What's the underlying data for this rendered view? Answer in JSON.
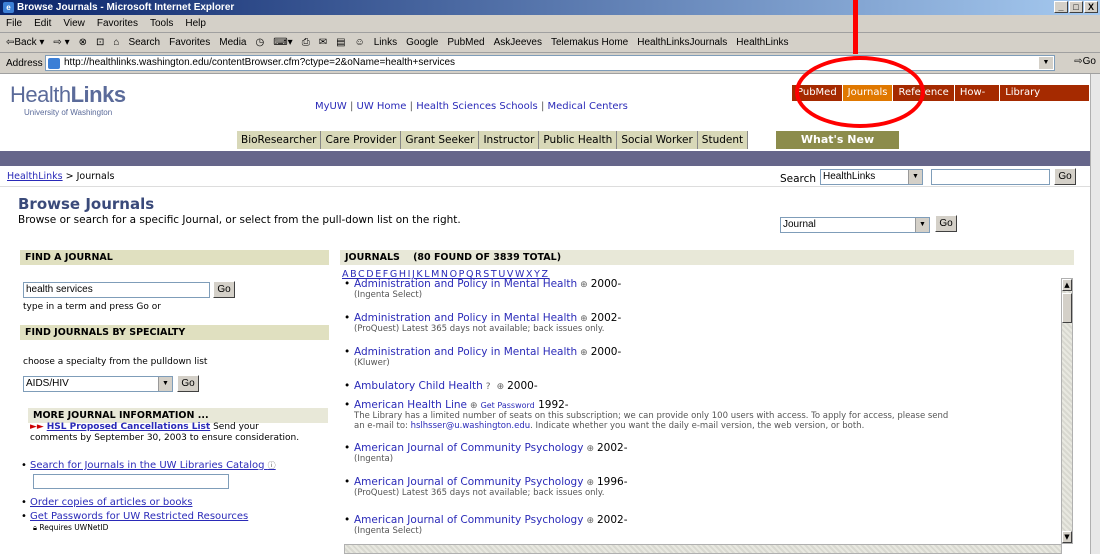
{
  "window": {
    "title": "Browse Journals - Microsoft Internet Explorer",
    "controls": [
      "_",
      "□",
      "X"
    ]
  },
  "menu": [
    "File",
    "Edit",
    "View",
    "Favorites",
    "Tools",
    "Help"
  ],
  "toolbar": [
    "⇦Back ▾",
    "⇨ ▾",
    "⊗",
    "⊡",
    "⌂",
    "Search",
    "Favorites",
    "Media",
    "◷",
    "⌨▾",
    "⎙",
    "✉",
    "▤",
    "☺",
    "Links",
    "Google",
    "PubMed",
    "AskJeeves",
    "Telemakus Home",
    "HealthLinksJournals",
    "HealthLinks"
  ],
  "address": {
    "label": "Address",
    "url": "http://healthlinks.washington.edu/contentBrowser.cfm?ctype=2&oName=health+services",
    "go": "Go"
  },
  "logo": {
    "main_light": "Health",
    "main_bold": "Links",
    "sub": "University of Washington"
  },
  "top_links": [
    "MyUW",
    "UW Home",
    "Health Sciences Schools",
    "Medical Centers"
  ],
  "resource_tabs": [
    {
      "label": "PubMed",
      "active": false
    },
    {
      "label": "Journals",
      "active": true
    },
    {
      "label": "Reference",
      "active": false
    },
    {
      "label": "How-To",
      "active": false
    },
    {
      "label": "Library Services",
      "active": false
    }
  ],
  "audience_tabs": [
    "BioResearcher",
    "Care Provider",
    "Grant Seeker",
    "Instructor",
    "Public Health",
    "Social Worker",
    "Student"
  ],
  "whats_new": "What's New",
  "breadcrumb": {
    "home": "HealthLinks",
    "sep": " > ",
    "current": "Journals"
  },
  "search": {
    "label": "Search",
    "scope": "HealthLinks",
    "value": "",
    "go": "Go"
  },
  "page_title": "Browse Journals",
  "intro": "Browse or search for a specific Journal, or select from the pull-down list on the right.",
  "journal_select": {
    "value": "Journal",
    "go": "Go"
  },
  "find_journal": {
    "header": "FIND A JOURNAL",
    "value": "health services",
    "go": "Go",
    "hint": "type in a term and press Go or"
  },
  "specialty": {
    "header": "FIND JOURNALS BY SPECIALTY",
    "hint": "choose a specialty from the pulldown list",
    "value": "AIDS/HIV",
    "go": "Go"
  },
  "more_info": {
    "header": "MORE JOURNAL INFORMATION ...",
    "cancellation_link": "HSL Proposed Cancellations List",
    "cancellation_text_1": "Send your",
    "cancellation_text_2": "comments by September 30, 2003 to ensure consideration.",
    "catalog_link": "Search for Journals in the UW Libraries Catalog",
    "order_link": "Order copies of articles or books",
    "password_link": "Get Passwords for UW Restricted Resources",
    "requires": "Requires UWNetID"
  },
  "journals_header": {
    "label": "JOURNALS",
    "count": "(80 FOUND OF 3839 TOTAL)"
  },
  "letters": "ABCDEFGHIJKLMNOPQRSTUVWXYZ",
  "journals": [
    {
      "title": "Administration and Policy in Mental Health",
      "year": "2000-",
      "note": "(Ingenta Select)"
    },
    {
      "title": "Administration and Policy in Mental Health",
      "year": "2002-",
      "note": "(ProQuest) Latest 365 days not available; back issues only."
    },
    {
      "title": "Administration and Policy in Mental Health",
      "year": "2000-",
      "note": "(Kluwer)"
    },
    {
      "title": "Ambulatory Child Health",
      "year": "2000-",
      "note": ""
    },
    {
      "title": "American Health Line",
      "password": "Get Password",
      "year": "1992-",
      "note1": "The Library has a limited number of seats on this subscription; we can provide only 100 users with access. To apply for access, please send",
      "note2a": "an e-mail to: ",
      "email": "hslhsser@u.washington.edu",
      "note2b": ". Indicate whether you want the daily e-mail version, the web version, or both."
    },
    {
      "title": "American Journal of Community Psychology",
      "year": "2002-",
      "note": "(Ingenta)"
    },
    {
      "title": "American Journal of Community Psychology",
      "year": "1996-",
      "note": "(ProQuest) Latest 365 days not available; back issues only."
    },
    {
      "title": "American Journal of Community Psychology",
      "year": "2002-",
      "note": "(Ingenta Select)"
    }
  ]
}
